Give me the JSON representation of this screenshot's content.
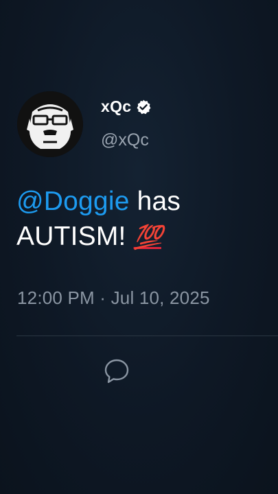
{
  "tweet": {
    "display_name": "xQc",
    "verified": true,
    "handle": "@xQc",
    "text_mention": "@Doggie",
    "text_rest_1": " has",
    "text_rest_2": "AUTISM! ",
    "emoji": "💯",
    "timestamp": "12:00 PM · Jul 10, 2025"
  },
  "icons": {
    "avatar": "gorilla-with-glasses-avatar",
    "verified": "verified-badge-icon",
    "reply": "reply-bubble-icon"
  },
  "colors": {
    "background": "#0e1620",
    "mention": "#1d9bf0",
    "secondary_text": "#8b96a3",
    "emoji_red": "#e0243a"
  }
}
